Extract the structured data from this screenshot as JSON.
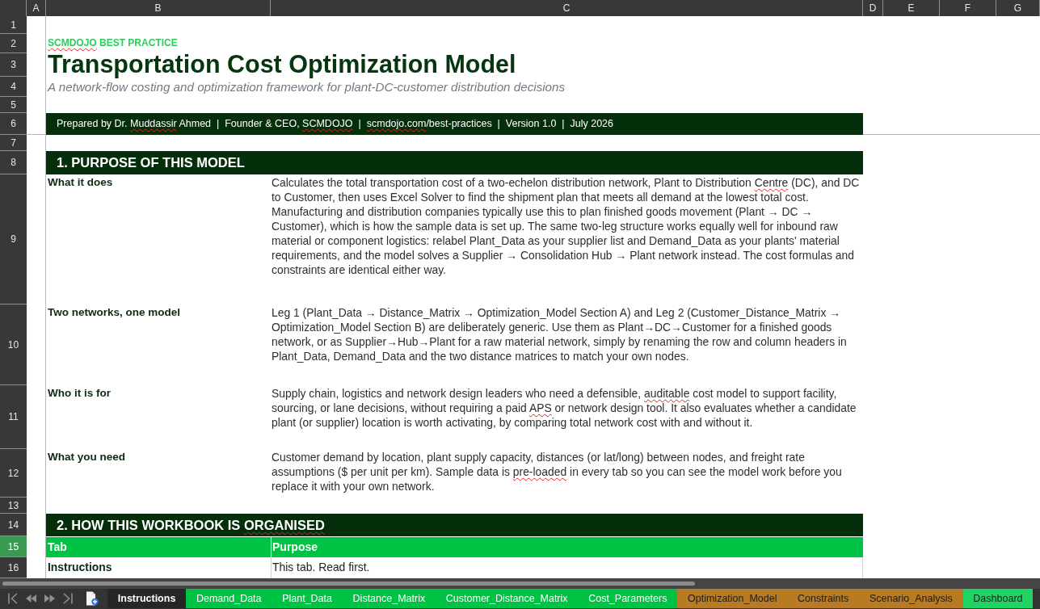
{
  "column_headers": [
    "A",
    "B",
    "C",
    "D",
    "E",
    "F",
    "G"
  ],
  "row_headers": [
    {
      "label": "1",
      "selected": false
    },
    {
      "label": "2",
      "selected": false
    },
    {
      "label": "3",
      "selected": false
    },
    {
      "label": "4",
      "selected": false
    },
    {
      "label": "5",
      "selected": false
    },
    {
      "label": "6",
      "selected": false
    },
    {
      "label": "7",
      "selected": false
    },
    {
      "label": "8",
      "selected": false
    },
    {
      "label": "9",
      "selected": false
    },
    {
      "label": "10",
      "selected": false
    },
    {
      "label": "11",
      "selected": false
    },
    {
      "label": "12",
      "selected": false
    },
    {
      "label": "13",
      "selected": false
    },
    {
      "label": "14",
      "selected": false
    },
    {
      "label": "15",
      "selected": true
    },
    {
      "label": "16",
      "selected": false
    }
  ],
  "brand_label": [
    {
      "text": "SCMDOJO",
      "misspelled": true
    },
    {
      "text": " BEST PRACTICE",
      "misspelled": false
    }
  ],
  "title": "Transportation Cost Optimization Model",
  "subtitle": "A network-flow costing and optimization framework for plant-DC-customer distribution decisions",
  "credit_banner": [
    {
      "text": "Prepared by Dr. ",
      "misspelled": false
    },
    {
      "text": "Muddassir",
      "misspelled": true
    },
    {
      "text": " Ahmed  |  Founder & CEO, ",
      "misspelled": false
    },
    {
      "text": "SCMDOJO",
      "misspelled": true
    },
    {
      "text": "  |  ",
      "misspelled": false
    },
    {
      "text": "scmdojo.com",
      "misspelled": true
    },
    {
      "text": "/best-practices  |  Version 1.0  |  July 2026",
      "misspelled": false
    }
  ],
  "sections": [
    {
      "kind": "definitions",
      "heading": [
        {
          "text": "1. PURPOSE OF THIS MODEL",
          "misspelled": false
        }
      ],
      "items": [
        {
          "label": "What it does",
          "text": [
            {
              "text": "Calculates the total transportation cost of a two-echelon distribution network, Plant to Distribution ",
              "misspelled": false
            },
            {
              "text": "Centre",
              "misspelled": true
            },
            {
              "text": " (DC), and DC to Customer, then uses Excel Solver to find the shipment plan that meets all demand at the lowest total cost. Manufacturing and distribution companies typically use this to plan finished goods movement (Plant → DC → Customer), which is how the sample data is set up. The same two-leg structure works equally well for inbound raw material or component logistics: relabel Plant_Data as your supplier list and Demand_Data as your plants' material requirements, and the model solves a Supplier → Consolidation Hub → Plant network instead. The cost formulas and constraints are identical either way.",
              "misspelled": false
            }
          ]
        },
        {
          "label": "Two networks, one model",
          "text": [
            {
              "text": "Leg 1 (Plant_Data → Distance_Matrix → Optimization_Model Section A) and Leg 2 (Customer_Distance_Matrix → Optimization_Model Section B) are deliberately generic. Use them as Plant→DC→Customer for a finished goods network, or as Supplier→Hub→Plant for a raw material network, simply by renaming the row and column headers in Plant_Data, Demand_Data and the two distance matrices to match your own nodes.",
              "misspelled": false
            }
          ]
        },
        {
          "label": "Who it is for",
          "text": [
            {
              "text": "Supply chain, logistics and network design leaders who need a defensible, ",
              "misspelled": false
            },
            {
              "text": "auditable",
              "misspelled": true
            },
            {
              "text": " cost model to support facility, sourcing, or lane decisions, without requiring a paid ",
              "misspelled": false
            },
            {
              "text": "APS",
              "misspelled": true
            },
            {
              "text": " or network design tool. It also evaluates whether a candidate plant (or supplier) location is worth activating, by comparing total network cost with and without it.",
              "misspelled": false
            }
          ]
        },
        {
          "label": "What you need",
          "text": [
            {
              "text": "Customer demand by location, plant supply capacity, distances (or lat/long) between nodes, and freight rate assumptions ($ per unit per km). Sample data is ",
              "misspelled": false
            },
            {
              "text": "pre-loaded",
              "misspelled": true
            },
            {
              "text": " in every tab so you can see the model work before you replace it with your own network.",
              "misspelled": false
            }
          ]
        }
      ]
    },
    {
      "kind": "table",
      "heading": [
        {
          "text": "2. HOW THIS WORKBOOK IS ",
          "misspelled": false
        },
        {
          "text": "ORGANISED",
          "misspelled": true
        }
      ],
      "columns": [
        "Tab",
        "Purpose"
      ],
      "rows": [
        {
          "cells": [
            "Instructions",
            "This tab. Read first."
          ]
        }
      ]
    }
  ],
  "sheet_tabs": [
    {
      "label": "Instructions",
      "selected": true
    },
    {
      "label": "Demand_Data",
      "selected": false,
      "color": "#00c244"
    },
    {
      "label": "Plant_Data",
      "selected": false,
      "color": "#00c244"
    },
    {
      "label": "Distance_Matrix",
      "selected": false,
      "color": "#00c244"
    },
    {
      "label": "Customer_Distance_Matrix",
      "selected": false,
      "color": "#00c244"
    },
    {
      "label": "Cost_Parameters",
      "selected": false,
      "color": "#00c244"
    },
    {
      "label": "Optimization_Model",
      "selected": false,
      "color": "#b87a22"
    },
    {
      "label": "Constraints",
      "selected": false,
      "color": "#b87a22"
    },
    {
      "label": "Scenario_Analysis",
      "selected": false,
      "color": "#b87a22"
    },
    {
      "label": "Dashboard",
      "selected": false,
      "color": "#1fd463"
    }
  ]
}
